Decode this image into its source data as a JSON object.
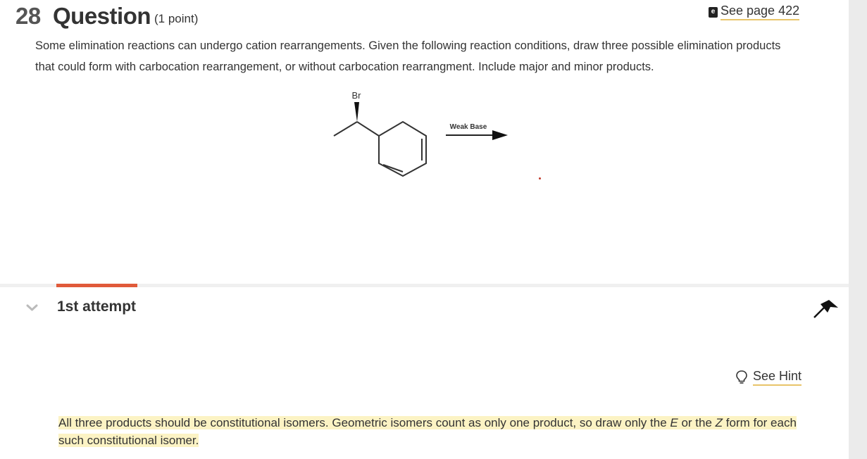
{
  "question": {
    "number": "28",
    "title": "Question",
    "points": "(1 point)",
    "see_page": "See page 422",
    "ebook_icon": "e",
    "prompt": "Some elimination reactions can undergo cation rearrangements. Given the following reaction conditions, draw three possible elimination products that could form with carbocation rearrangement, or without carbocation rearrangment.  Include major and minor products."
  },
  "reaction": {
    "substituent_label": "Br",
    "reagent_label": "Weak Base"
  },
  "attempt": {
    "label": "1st attempt",
    "accent_color": "#e05a3a"
  },
  "hint": {
    "link_label": "See Hint",
    "text_part1": "All three products should be constitutional isomers.  Geometric isomers count as only one product, so draw only the ",
    "e_letter": "E",
    "text_part2": " or the ",
    "z_letter": "Z",
    "text_part3": " form for each such constitutional isomer.",
    "highlight_color": "#fcf3c4"
  },
  "icons": {
    "ebook": "ebook-icon",
    "chevron": "chevron-down-icon",
    "flag": "flag-icon",
    "hint": "lightbulb-icon"
  }
}
